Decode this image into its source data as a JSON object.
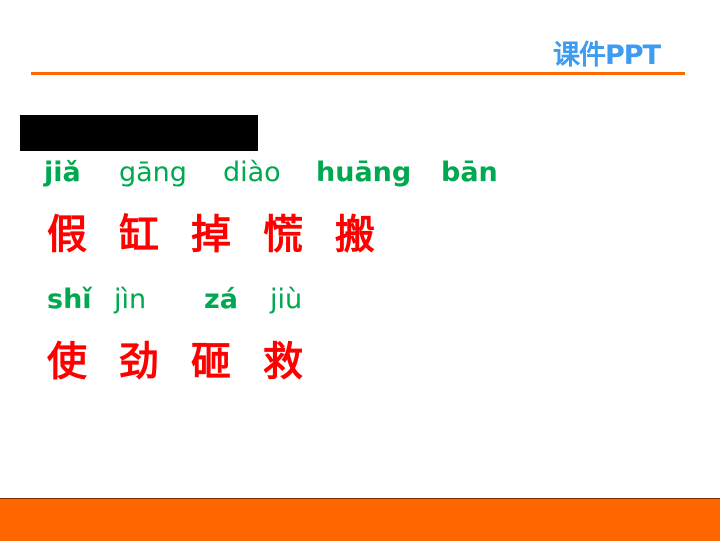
{
  "header": {
    "logo_text": "课件PPT"
  },
  "row1": {
    "pinyin": [
      "jiǎ",
      "gāng",
      "diào",
      "huāng",
      "bān"
    ],
    "chars": [
      "假",
      "缸",
      "掉",
      "慌",
      "搬"
    ]
  },
  "row2": {
    "pinyin": [
      "shǐ",
      "jìn",
      "zá",
      "jiù"
    ],
    "chars": [
      "使",
      "劲",
      "砸",
      "救"
    ]
  },
  "colors": {
    "accent": "#ff6600",
    "pinyin": "#00a84f",
    "hanzi": "#ff0000",
    "logo": "#3d9bf0"
  }
}
